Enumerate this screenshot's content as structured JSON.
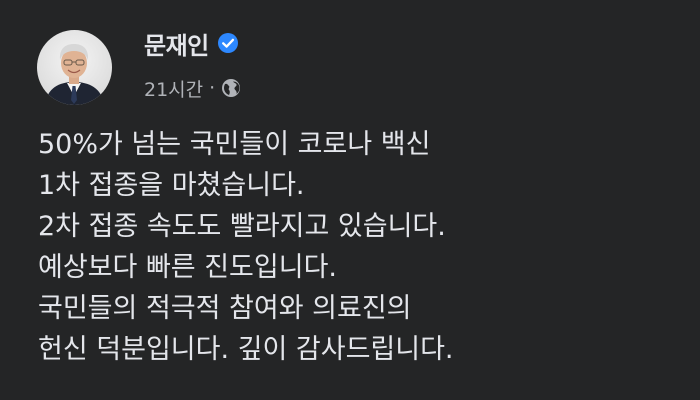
{
  "post": {
    "author": {
      "name": "문재인",
      "verified": true,
      "avatar": "avatar-photo"
    },
    "meta": {
      "timestamp": "21시간",
      "separator": "·",
      "audience_icon": "globe-icon"
    },
    "body": {
      "lines": [
        "50%가 넘는 국민들이 코로나 백신",
        "1차 접종을 마쳤습니다.",
        "2차 접종 속도도 빨라지고 있습니다.",
        "예상보다 빠른 진도입니다.",
        "국민들의 적극적 참여와 의료진의",
        "헌신 덕분입니다. 깊이 감사드립니다."
      ]
    }
  },
  "colors": {
    "background": "#242526",
    "primary_text": "#e4e6eb",
    "secondary_text": "#b0b3b8",
    "verified_badge": "#2d88ff"
  }
}
